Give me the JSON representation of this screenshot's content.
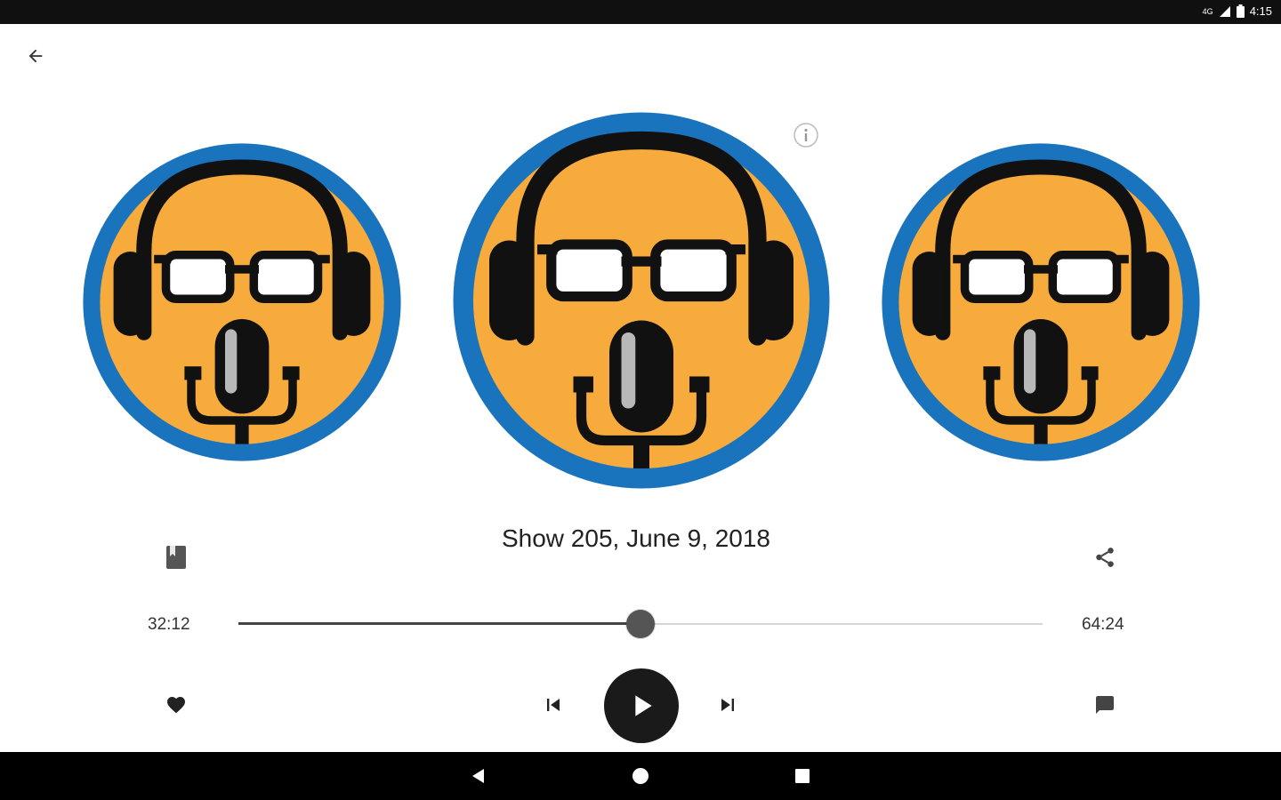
{
  "status_bar": {
    "network": "4G",
    "time": "4:15"
  },
  "episode": {
    "title": "Show 205, June 9, 2018"
  },
  "playback": {
    "elapsed": "32:12",
    "total": "64:24",
    "progress": 0.5
  },
  "colors": {
    "artwork_blue": "#1a73bd",
    "artwork_orange": "#f6ab3c",
    "control_dark": "#1a1a1a"
  },
  "icons": {
    "back": "arrow-left-icon",
    "info": "info-icon",
    "chapters": "book-icon",
    "share": "share-icon",
    "favorite": "heart-icon",
    "previous": "skip-previous-icon",
    "play": "play-icon",
    "next": "skip-next-icon",
    "comments": "comment-icon"
  }
}
